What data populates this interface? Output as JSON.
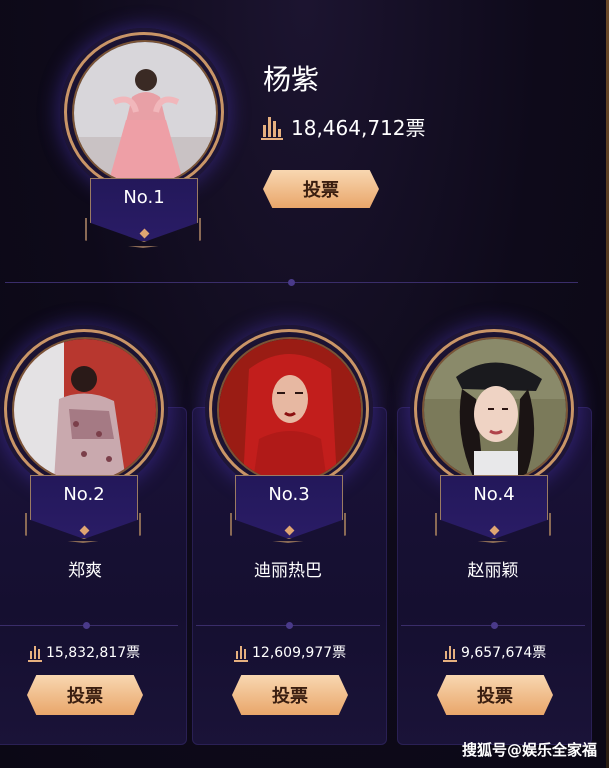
{
  "leader": {
    "rank": "No.1",
    "name": "杨紫",
    "votes": "18,464,712票",
    "vote_button": "投票"
  },
  "contestants": [
    {
      "rank": "No.2",
      "name": "郑爽",
      "votes": "15,832,817票",
      "vote_button": "投票"
    },
    {
      "rank": "No.3",
      "name": "迪丽热巴",
      "votes": "12,609,977票",
      "vote_button": "投票"
    },
    {
      "rank": "No.4",
      "name": "赵丽颖",
      "votes": "9,657,674票",
      "vote_button": "投票"
    }
  ],
  "watermark": "搜狐号@娱乐全家福",
  "icons": {
    "votes": "bar-chart-icon",
    "rank_gem": "diamond-icon"
  },
  "colors": {
    "accent_gold": "#e9a66a",
    "banner_navy": "#23185a",
    "background": "#0e0a1a"
  }
}
